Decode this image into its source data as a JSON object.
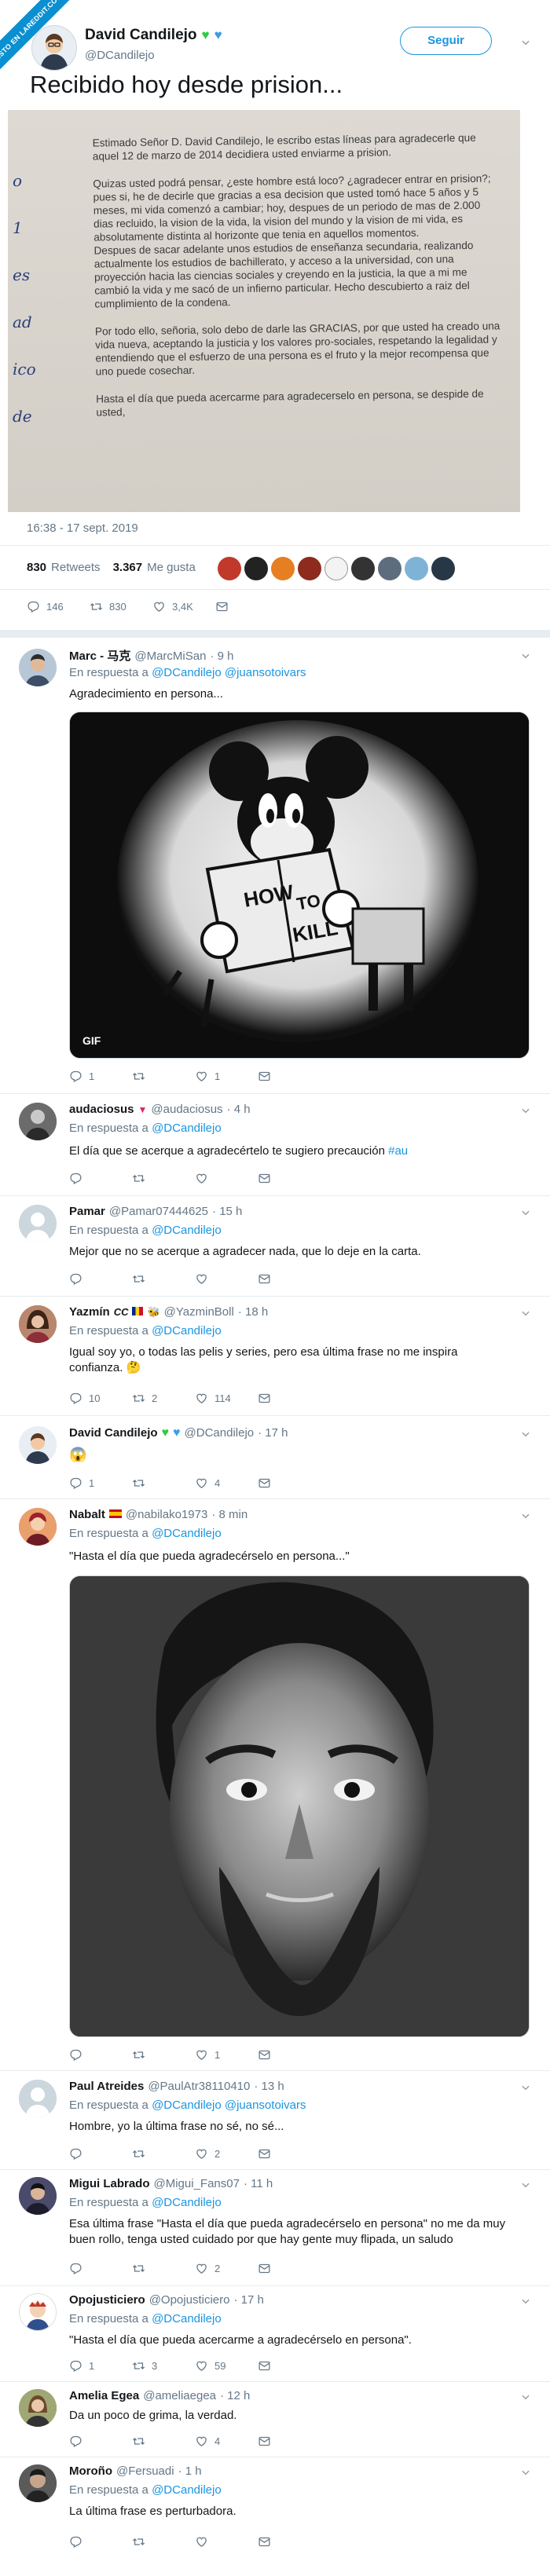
{
  "banner": {
    "text": "VISTO EN LAREDDIT.COM"
  },
  "main": {
    "name": "David Candilejo",
    "handle": "@DCandilejo",
    "follow": "Seguir",
    "text": "Recibido hoy desde prision...",
    "letter": {
      "greeting": "Estimado Señor D. David Candilejo, le escribo estas líneas para agradecerle que aquel 12 de marzo de 2014 decidiera usted enviarme a prision.",
      "p1": "Quizas usted podrá pensar, ¿este hombre está loco? ¿agradecer entrar en prision?; pues si, he de decirle que gracias a esa decision que usted tomó hace 5 años y 5 meses, mi vida comenzó a cambiar; hoy, despues de un periodo de mas de 2.000 dias recluido, la vision de la vida, la vision del mundo y la vision de mi vida, es absolutamente distinta al horizonte que tenia en aquellos momentos.",
      "p2": "Despues de sacar adelante unos estudios de enseñanza secundaria, realizando actualmente los estudios de bachillerato, y acceso a la universidad, con una proyección hacia las ciencias sociales y creyendo en la justicia, la que a mi me cambió la vida y me sacó de un infierno particular. Hecho descubierto a raiz del cumplimiento de la condena.",
      "p3": "Por todo ello, señoria, solo debo de darle las GRACIAS, por que usted ha creado una vida nueva, aceptando la justicia y los valores pro-sociales, respetando la legalidad y entendiendo que el esfuerzo de una persona es el fruto y la mejor recompensa que uno puede cosechar.",
      "p4": "Hasta el día que pueda acercarme para agradecerselo en persona, se despide de usted,"
    },
    "timestamp": "16:38 - 17 sept. 2019",
    "retweets_num": "830",
    "retweets_label": "Retweets",
    "likes_num": "3.367",
    "likes_label": "Me gusta",
    "replies": "146",
    "rt": "830",
    "fav": "3,4K"
  },
  "replies": [
    {
      "name": "Marc - 马克",
      "handle": "@MarcMiSan",
      "time": "· 9 h",
      "reply_prefix": "En respuesta a",
      "mentions": "@DCandilejo @juansotoivars",
      "text": "Agradecimiento en persona...",
      "media_title": "HOW TO KILL",
      "gif": "GIF",
      "c": "1",
      "r": "",
      "l": "1"
    },
    {
      "name": "audaciosus",
      "handle": "@audaciosus",
      "time": "· 4 h",
      "reply_prefix": "En respuesta a",
      "mentions": "@DCandilejo",
      "text": "El día que se acerque a agradecértelo te sugiero precaución",
      "hashtag": "#au",
      "c": "",
      "r": "",
      "l": ""
    },
    {
      "name": "Pamar",
      "handle": "@Pamar07444625",
      "time": "· 15 h",
      "reply_prefix": "En respuesta a",
      "mentions": "@DCandilejo",
      "text": "Mejor que no se acerque a agradecer nada, que lo deje en la carta.",
      "c": "",
      "r": "",
      "l": ""
    },
    {
      "name": "Yazmín",
      "handle": "@YazminBoll",
      "time": "· 18 h",
      "reply_prefix": "En respuesta a",
      "mentions": "@DCandilejo",
      "text": "Igual soy yo, o todas las pelis y series, pero esa última frase no me inspira confianza. 🤔",
      "c": "10",
      "r": "2",
      "l": "114"
    },
    {
      "name": "David Candilejo",
      "handle": "@DCandilejo",
      "time": "· 17 h",
      "text": "😱",
      "c": "1",
      "r": "",
      "l": "4"
    },
    {
      "name": "Nabalt",
      "handle": "@nabilako1973",
      "time": "· 8 min",
      "reply_prefix": "En respuesta a",
      "mentions": "@DCandilejo",
      "text": "\"Hasta el día que pueda agradecérselo en persona...\"",
      "c": "",
      "r": "",
      "l": "1"
    },
    {
      "name": "Paul Atreides",
      "handle": "@PaulAtr38110410",
      "time": "· 13 h",
      "reply_prefix": "En respuesta a",
      "mentions": "@DCandilejo @juansotoivars",
      "text": "Hombre, yo la última frase no sé, no sé...",
      "c": "",
      "r": "",
      "l": "2"
    },
    {
      "name": "Migui Labrado",
      "handle": "@Migui_Fans07",
      "time": "· 11 h",
      "reply_prefix": "En respuesta a",
      "mentions": "@DCandilejo",
      "text": "Esa última frase \"Hasta el día que pueda agradecérselo en persona\" no me da muy buen rollo, tenga usted cuidado por que hay gente muy flipada, un saludo",
      "c": "",
      "r": "",
      "l": "2"
    },
    {
      "name": "Opojusticiero",
      "handle": "@Opojusticiero",
      "time": "· 17 h",
      "reply_prefix": "En respuesta a",
      "mentions": "@DCandilejo",
      "text": "\"Hasta el día que pueda acercarme a agradecérselo en persona\".",
      "c": "1",
      "r": "3",
      "l": "59"
    },
    {
      "name": "Amelia Egea",
      "handle": "@ameliaegea",
      "time": "· 12 h",
      "text": "Da un poco de grima, la verdad.",
      "c": "",
      "r": "",
      "l": "4"
    },
    {
      "name": "Moroño",
      "handle": "@Fersuadi",
      "time": "· 1 h",
      "reply_prefix": "En respuesta a",
      "mentions": "@DCandilejo",
      "text": "La última frase es perturbadora.",
      "c": "",
      "r": "",
      "l": ""
    }
  ]
}
